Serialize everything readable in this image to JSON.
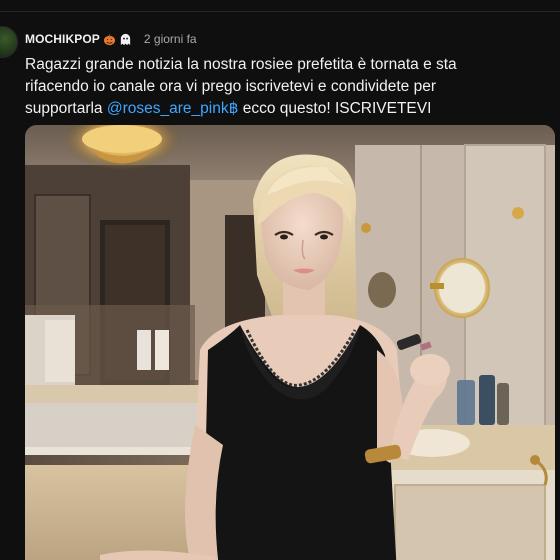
{
  "post": {
    "author": "MOCHIKPOP",
    "author_emojis": [
      "jack-o-lantern-icon",
      "ghost-icon"
    ],
    "time": "2 giorni fa",
    "text_before": "Ragazzi grande notizia la nostra rosiee prefetita è tornata e sta rifacendo io canale ora vi prego iscrivetevi e condividete per supportarla ",
    "mention": "@roses_are_pink฿",
    "text_after": " ecco questo! ISCRIVETEVI"
  },
  "colors": {
    "background": "#0f0f0f",
    "text": "#f1f1f1",
    "secondary_text": "#aaaaaa",
    "link": "#3ea6ff"
  }
}
